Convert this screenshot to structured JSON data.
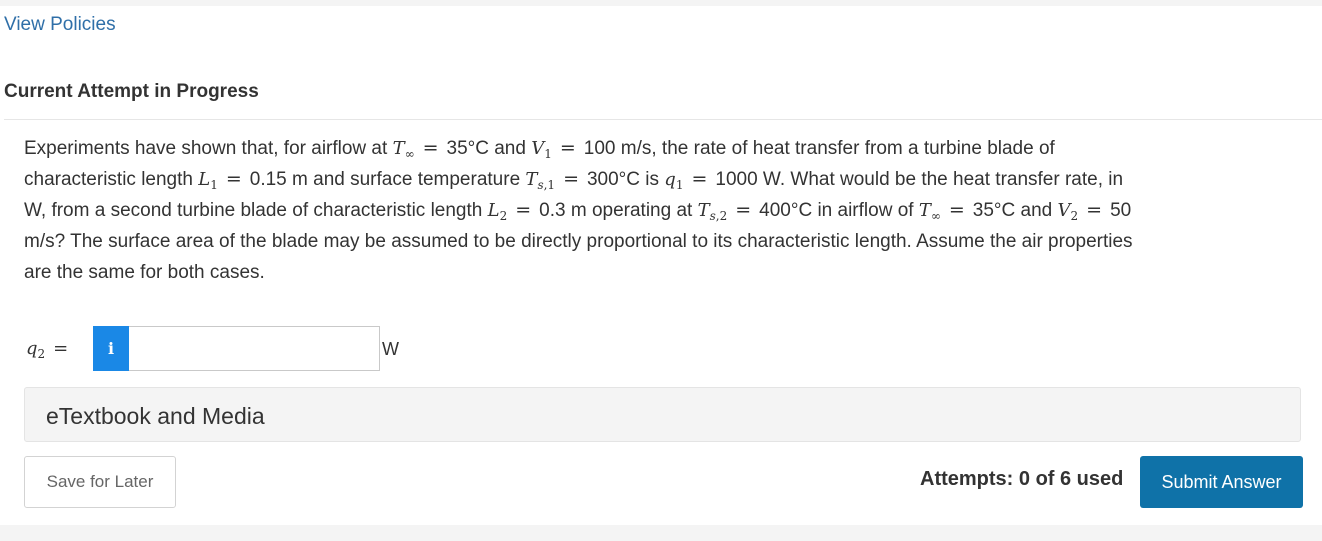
{
  "header": {
    "view_policies": "View Policies",
    "attempt_heading": "Current Attempt in Progress"
  },
  "question": {
    "line1": {
      "a": "Experiments have shown that, for airflow at ",
      "t_inf_sym": "T",
      "t_inf_sub": "∞",
      "eq": "=",
      "b": "35°C and ",
      "v1_sym": "V",
      "v1_sub": "1",
      "c": "100 m/s, the rate of heat transfer from a turbine blade of"
    },
    "line2": {
      "a": "characteristic length ",
      "l1_sym": "L",
      "l1_sub": "1",
      "b": "0.15 m and surface temperature ",
      "ts1_sym": "T",
      "ts1_sub_s": "s",
      "ts1_sub_n": ",1",
      "c": "300°C is ",
      "q1_sym": "q",
      "q1_sub": "1",
      "d": "1000 W. What would be the heat transfer rate, in"
    },
    "line3": {
      "a": "W, from a second turbine blade of characteristic length ",
      "l2_sym": "L",
      "l2_sub": "2",
      "b": "0.3 m operating at ",
      "ts2_sym": "T",
      "ts2_sub_s": "s",
      "ts2_sub_n": ",2",
      "c": "400°C in airflow of ",
      "t_inf_sym": "T",
      "t_inf_sub": "∞",
      "d": "35°C and ",
      "v2_sym": "V",
      "v2_sub": "2",
      "e": "50"
    },
    "line4": "m/s? The surface area of the blade may be assumed to be directly proportional to its characteristic length. Assume the air properties",
    "line5": "are the same for both cases."
  },
  "answer": {
    "label_sym": "q",
    "label_sub": "2",
    "eq": "=",
    "info_icon": "i",
    "value": "",
    "unit": "W"
  },
  "media": {
    "label": "eTextbook and Media"
  },
  "footer": {
    "save_label": "Save for Later",
    "attempts": "Attempts: 0 of 6 used",
    "submit_label": "Submit Answer"
  },
  "colors": {
    "link": "#2f6fa8",
    "info_button": "#1a88e6",
    "submit_button": "#0f72a8"
  }
}
